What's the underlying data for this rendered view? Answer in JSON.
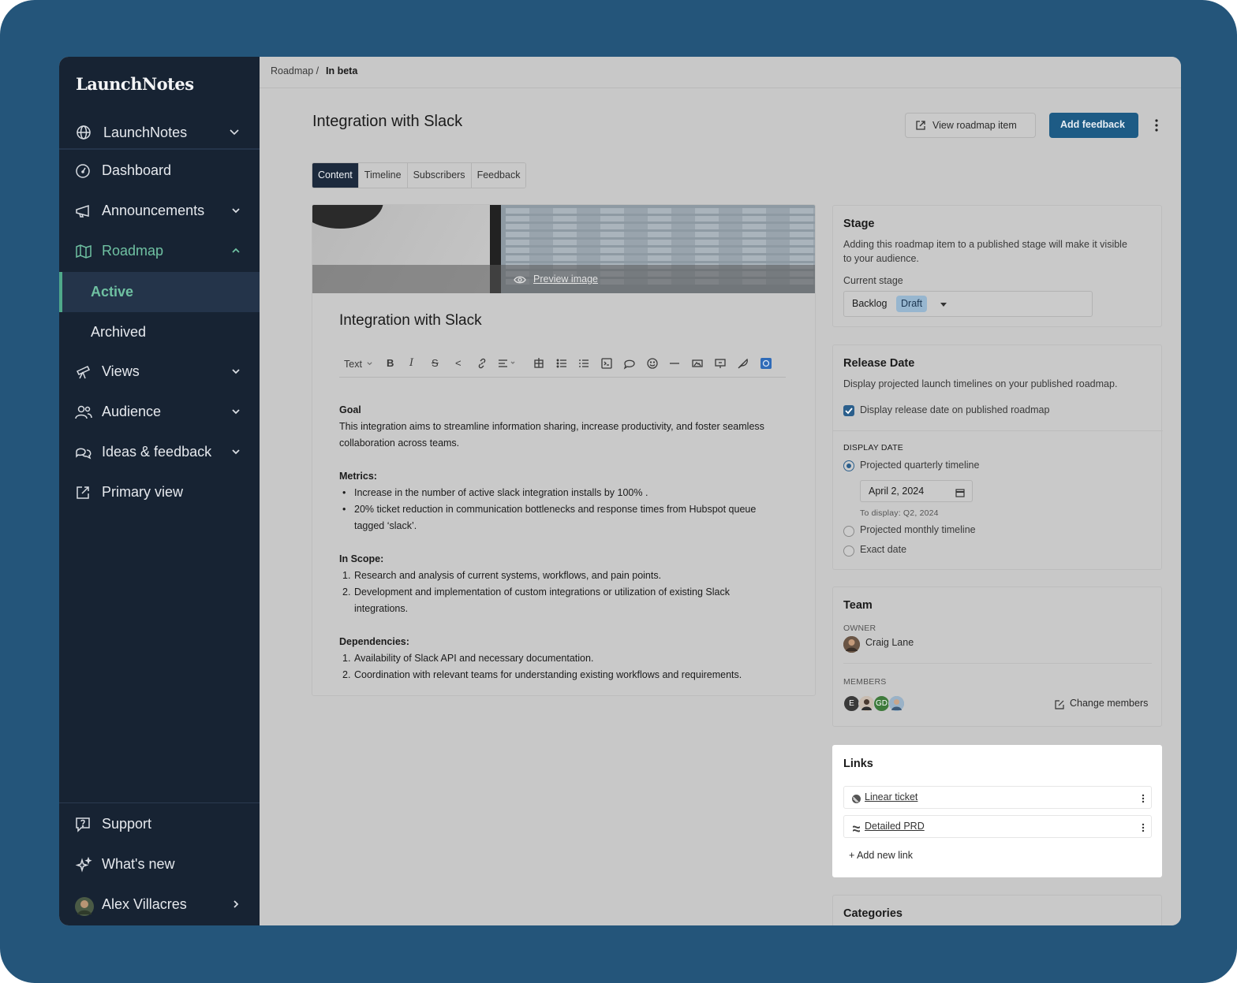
{
  "sidebar": {
    "logo": "LaunchNotes",
    "workspace": "LaunchNotes",
    "nav": {
      "dashboard": "Dashboard",
      "announcements": "Announcements",
      "roadmap": "Roadmap",
      "roadmap_sub": {
        "active": "Active",
        "archived": "Archived"
      },
      "views": "Views",
      "audience": "Audience",
      "ideas": "Ideas & feedback",
      "primary": "Primary view"
    },
    "bottom": {
      "support": "Support",
      "whats_new": "What's new",
      "user": "Alex Villacres"
    }
  },
  "breadcrumb": {
    "parent": "Roadmap /",
    "current": "In beta"
  },
  "header": {
    "title": "Integration with Slack",
    "view_button": "View roadmap item",
    "add_button": "Add feedback"
  },
  "tabs": [
    "Content",
    "Timeline",
    "Subscribers",
    "Feedback"
  ],
  "editor": {
    "preview_label": "Preview image",
    "title": "Integration with Slack",
    "toolbar_text": "Text",
    "goal_heading": "Goal",
    "goal_text_1": "This integration aims to streamline information sharing, increase productivity, and foster seamless",
    "goal_text_2": "collaboration across teams.",
    "metrics_heading": "Metrics:",
    "metrics": [
      "Increase in the number of active slack integration installs by 100% .",
      "20% ticket reduction in communication bottlenecks and response times from Hubspot queue",
      "tagged ‘slack’."
    ],
    "scope_heading": "In Scope:",
    "scope": [
      "Research and analysis of current systems, workflows, and pain points.",
      "Development and implementation of custom integrations or utilization of existing Slack",
      "integrations."
    ],
    "deps_heading": "Dependencies:",
    "deps": [
      "Availability of Slack API and necessary documentation.",
      "Coordination with relevant teams for understanding existing workflows and requirements."
    ]
  },
  "stage": {
    "title": "Stage",
    "desc_1": "Adding this roadmap item to a published stage will make it visible",
    "desc_2": "to your audience.",
    "label": "Current stage",
    "value": "Backlog",
    "badge": "Draft"
  },
  "release": {
    "title": "Release Date",
    "desc": "Display projected launch timelines on your published roadmap.",
    "checkbox": "Display release date on published roadmap",
    "display_label": "DISPLAY DATE",
    "option_quarterly": "Projected quarterly timeline",
    "date": "April 2, 2024",
    "to_display": "To display: Q2, 2024",
    "option_monthly": "Projected monthly timeline",
    "option_exact": "Exact date"
  },
  "team": {
    "title": "Team",
    "owner_label": "OWNER",
    "owner": "Craig Lane",
    "members_label": "MEMBERS",
    "member_initials": [
      "E",
      "GD"
    ],
    "change": "Change members"
  },
  "links": {
    "title": "Links",
    "items": [
      "Linear ticket",
      "Detailed PRD"
    ],
    "add": "+ Add new link"
  },
  "categories": {
    "title": "Categories"
  },
  "colors": {
    "sidebar": "#172333",
    "accent": "#1d5b85",
    "active_green": "#6fc1a2",
    "frame": "#24557a"
  }
}
